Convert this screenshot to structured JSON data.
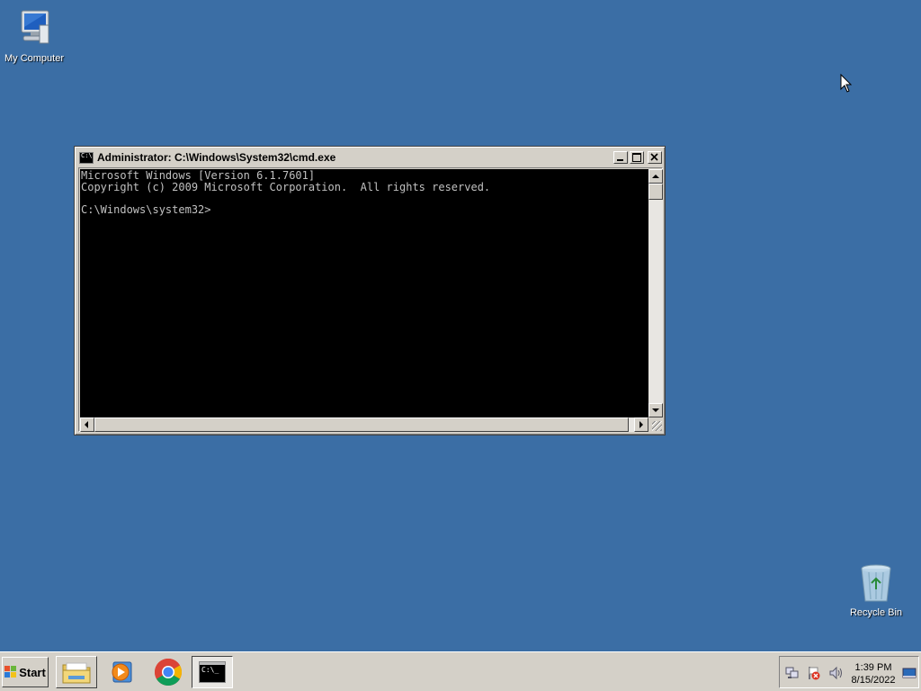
{
  "desktop": {
    "icons": [
      {
        "label": "My Computer",
        "icon": "my-computer-icon"
      },
      {
        "label": "Recycle Bin",
        "icon": "recycle-bin-icon"
      }
    ]
  },
  "cmd_window": {
    "title": "Administrator: C:\\Windows\\System32\\cmd.exe",
    "icon_text": "C:\\",
    "lines": [
      "Microsoft Windows [Version 6.1.7601]",
      "Copyright (c) 2009 Microsoft Corporation.  All rights reserved.",
      "",
      "C:\\Windows\\system32>"
    ],
    "colors": {
      "background": "#000000",
      "text": "#c0c0c0"
    }
  },
  "taskbar": {
    "start_label": "Start",
    "buttons": [
      {
        "name": "windows-explorer",
        "icon": "folder-icon"
      },
      {
        "name": "media-player",
        "icon": "media-player-icon"
      },
      {
        "name": "chrome",
        "icon": "chrome-icon"
      },
      {
        "name": "command-prompt",
        "icon": "cmd-icon",
        "icon_text": "C:\\_",
        "active": true
      }
    ],
    "tray": {
      "icons": [
        "network-icon",
        "action-center-icon",
        "volume-icon",
        "show-desktop-icon"
      ],
      "time": "1:39 PM",
      "date": "8/15/2022"
    }
  },
  "colors": {
    "desktop": "#3b6ea5",
    "taskbar": "#d4d0c8"
  }
}
